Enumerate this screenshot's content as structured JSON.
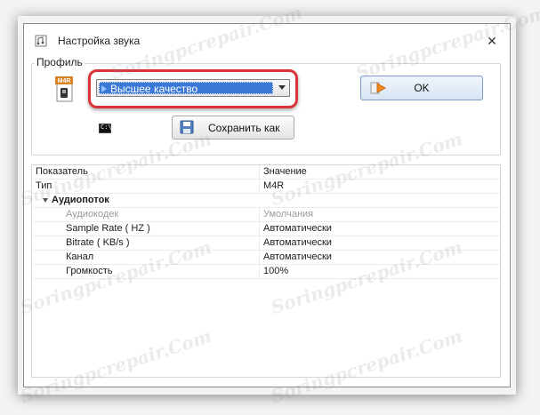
{
  "window": {
    "title": "Настройка звука",
    "close_glyph": "✕"
  },
  "profile": {
    "group_label": "Профиль",
    "file_icon_text": "M4R",
    "selected": "Высшее качество",
    "ok_label": "OK",
    "cmd_icon_text": "C:\\",
    "save_as_label": "Сохранить как"
  },
  "properties": {
    "header": [
      "Показатель",
      "Значение"
    ],
    "rows": [
      {
        "name": "Тип",
        "value": "M4R",
        "style": "normal"
      },
      {
        "name": "Аудиопоток",
        "value": "",
        "style": "group"
      },
      {
        "name": "Аудиокодек",
        "value": "Умолчания",
        "style": "gray"
      },
      {
        "name": "Sample Rate ( HZ )",
        "value": "Автоматически",
        "style": "sub"
      },
      {
        "name": "Bitrate ( KB/s )",
        "value": "Автоматически",
        "style": "sub"
      },
      {
        "name": "Канал",
        "value": "Автоматически",
        "style": "sub"
      },
      {
        "name": "Громкость",
        "value": "100%",
        "style": "sub"
      }
    ]
  },
  "watermark": "Soringpcrepair.Com",
  "colors": {
    "highlight": "#d9343a",
    "selection": "#3a78d6",
    "ok_button_border": "#7a9cc7"
  },
  "icons": [
    "app-icon",
    "close-icon",
    "m4r-file-icon",
    "dropdown-arrow-icon",
    "ok-arrow-icon",
    "console-icon",
    "floppy-disk-icon",
    "collapse-triangle-icon"
  ]
}
